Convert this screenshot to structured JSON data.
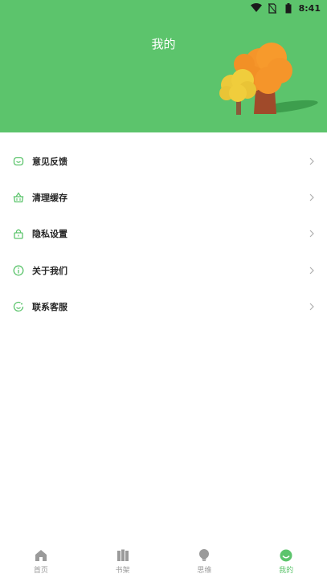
{
  "status_bar": {
    "time": "8:41",
    "icons": [
      "wifi-icon",
      "no-sim-icon",
      "battery-icon"
    ]
  },
  "header": {
    "title": "我的",
    "background_color": "#5cc46c",
    "illustration": "tree-illustration"
  },
  "menu": {
    "accent_color": "#5cc46c",
    "items": [
      {
        "label": "意见反馈",
        "icon": "feedback-icon"
      },
      {
        "label": "清理缓存",
        "icon": "clear-cache-icon"
      },
      {
        "label": "隐私设置",
        "icon": "lock-icon"
      },
      {
        "label": "关于我们",
        "icon": "info-icon"
      },
      {
        "label": "联系客服",
        "icon": "customer-service-icon"
      }
    ]
  },
  "tabbar": {
    "active_color": "#5cc46c",
    "inactive_color": "#9a9a9a",
    "items": [
      {
        "label": "首页",
        "icon": "home-icon",
        "active": false
      },
      {
        "label": "书架",
        "icon": "bookshelf-icon",
        "active": false
      },
      {
        "label": "思维",
        "icon": "lightbulb-icon",
        "active": false
      },
      {
        "label": "我的",
        "icon": "profile-icon",
        "active": true
      }
    ]
  }
}
